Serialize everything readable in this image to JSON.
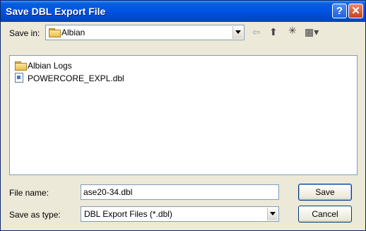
{
  "window": {
    "title": "Save DBL Export File",
    "help_glyph": "?",
    "close_glyph": "✕"
  },
  "toolbar": {
    "save_in_label": "Save in:",
    "save_in_value": "Albian",
    "back_glyph": "⇦",
    "up_glyph": "⬆",
    "new_folder_glyph": "✳",
    "views_glyph": "▦▾"
  },
  "files": [
    {
      "name": "Albian Logs",
      "icon": "folder-icon"
    },
    {
      "name": "POWERCORE_EXPL.dbl",
      "icon": "file-icon"
    }
  ],
  "filename": {
    "label": "File name:",
    "value": "ase20-34.dbl"
  },
  "filetype": {
    "label": "Save as type:",
    "value": "DBL Export Files (*.dbl)"
  },
  "buttons": {
    "save": "Save",
    "cancel": "Cancel"
  },
  "colors": {
    "titlebar": "#0054e3",
    "dialog": "#ece9d8",
    "close": "#c8401b"
  }
}
